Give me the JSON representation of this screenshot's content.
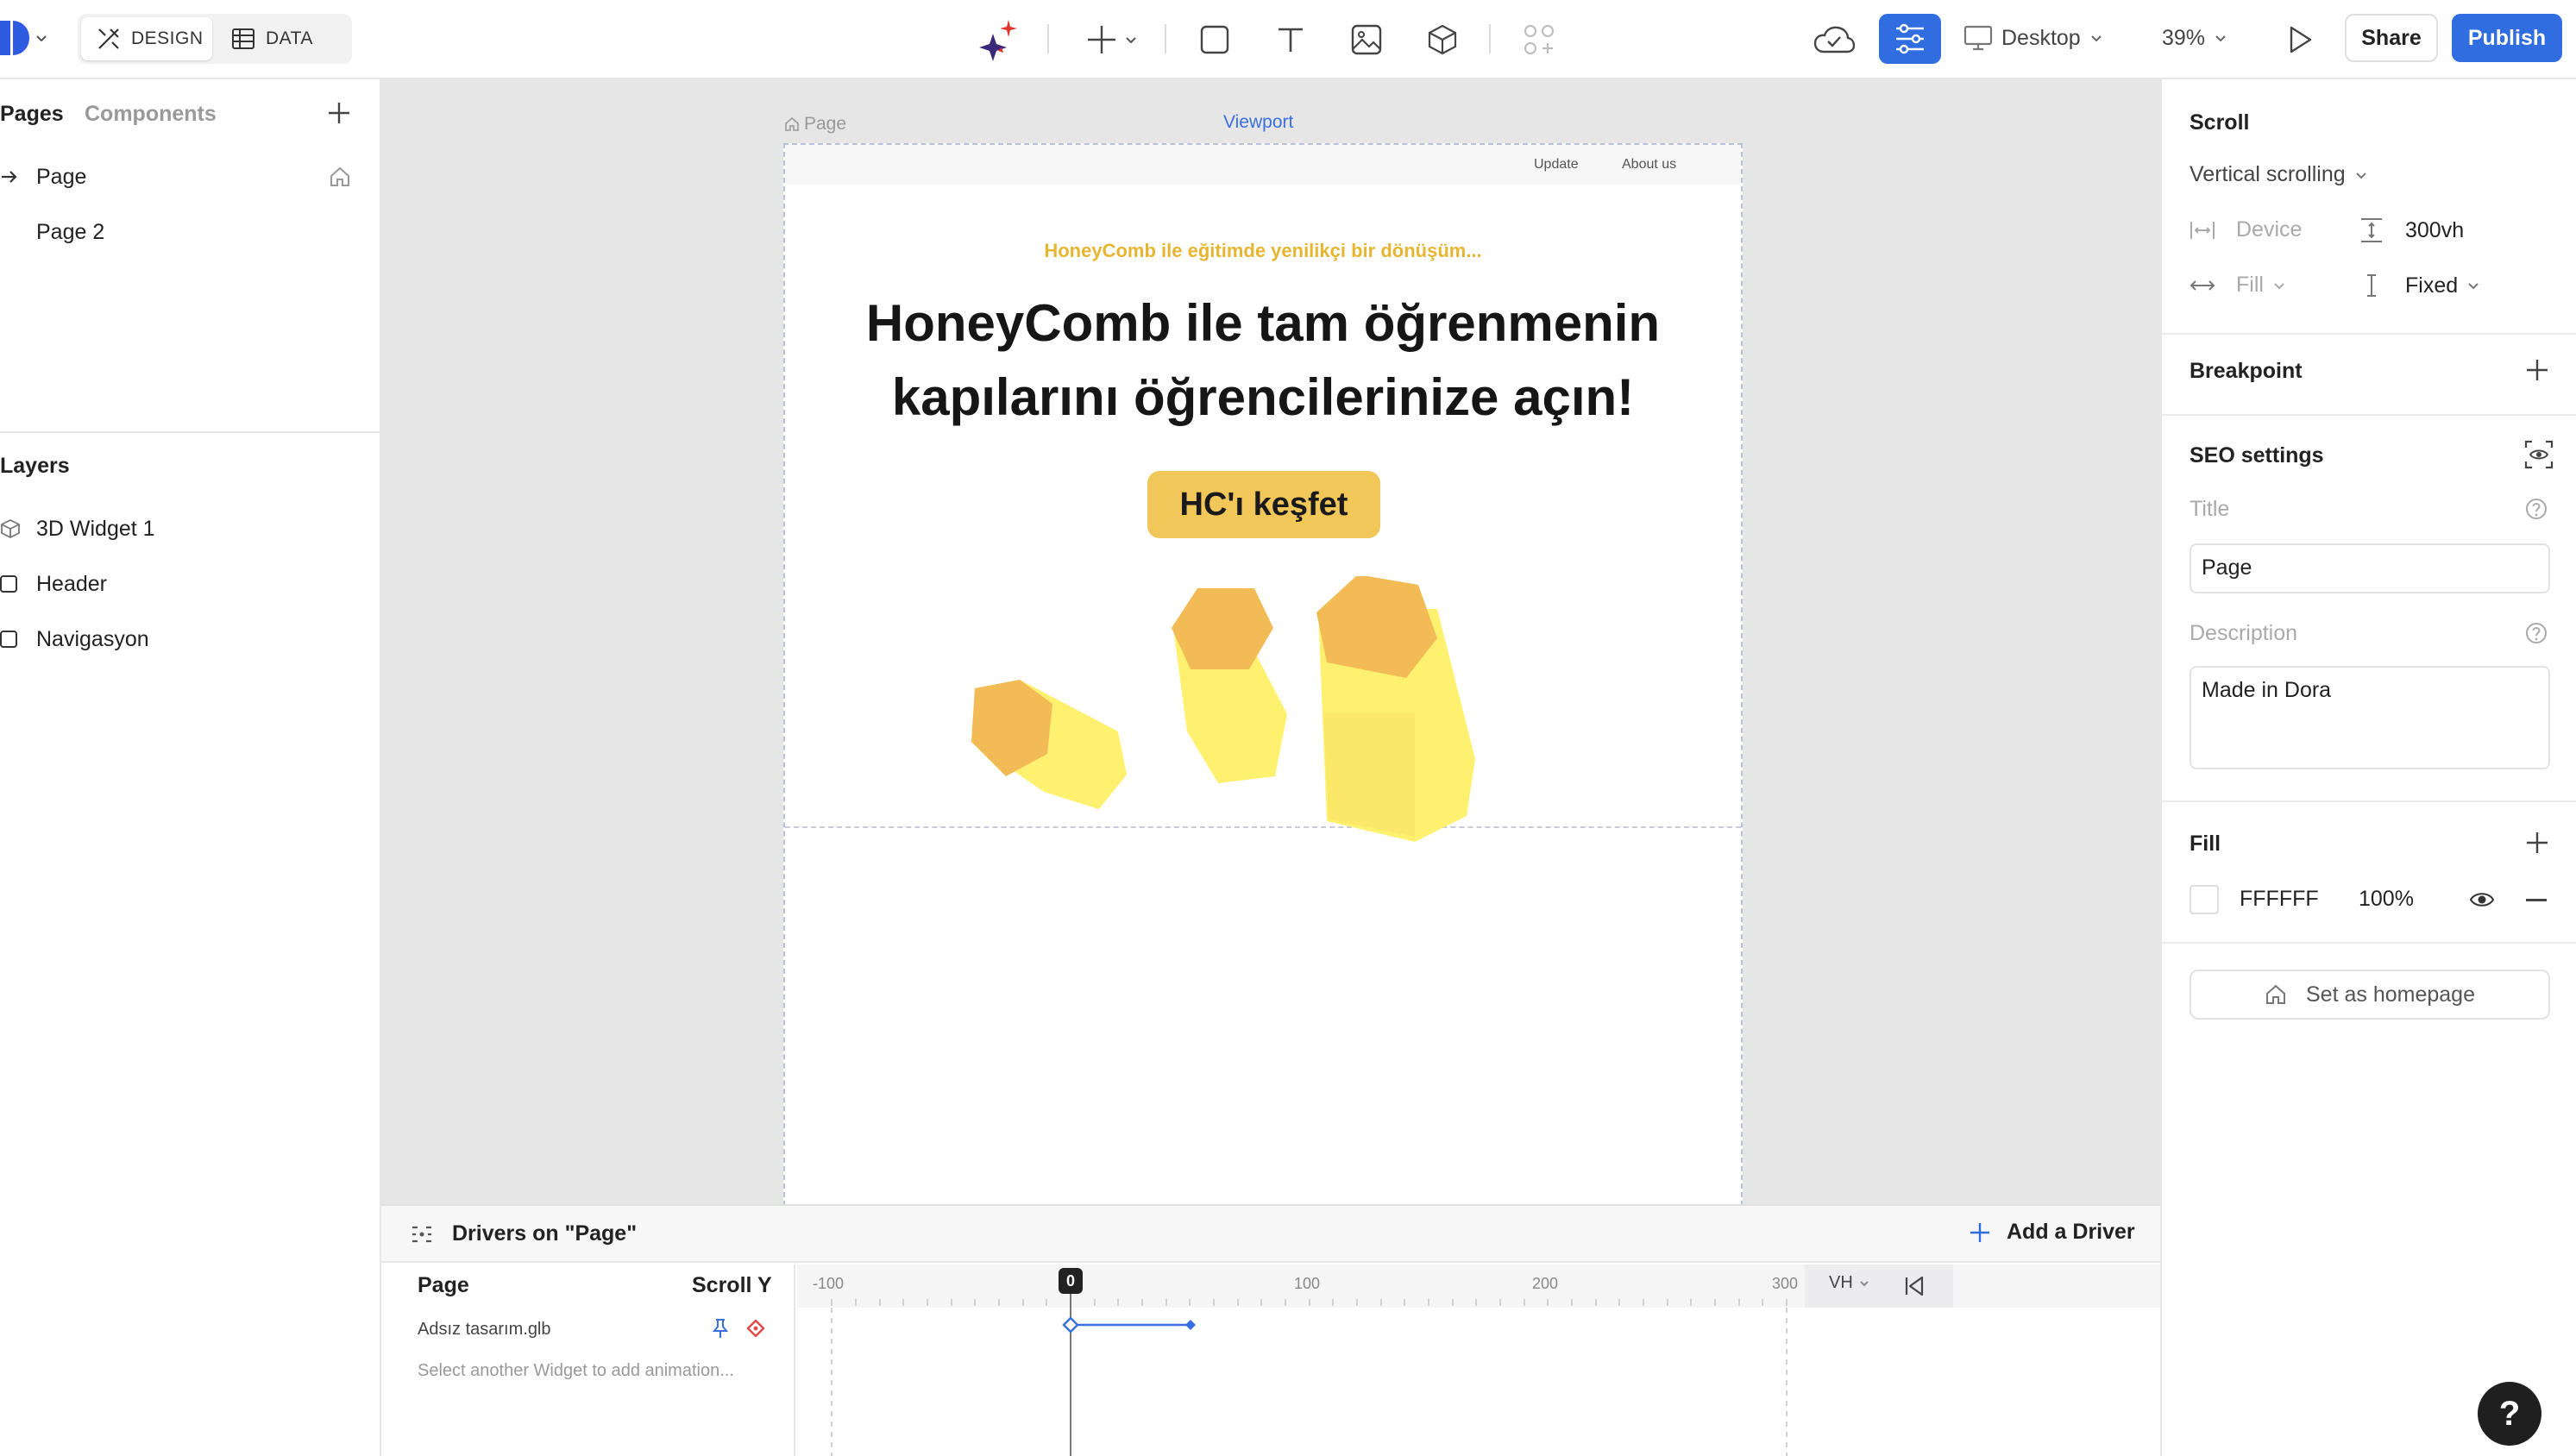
{
  "topbar": {
    "tabs": [
      {
        "label": "DESIGN",
        "icon": "design-tools-icon",
        "active": true
      },
      {
        "label": "DATA",
        "icon": "table-icon",
        "active": false
      }
    ],
    "device": "Desktop",
    "zoom": "39%",
    "share_label": "Share",
    "publish_label": "Publish",
    "accent": "#2f6de1"
  },
  "left": {
    "tabs": {
      "pages": "Pages",
      "components": "Components"
    },
    "pages": [
      {
        "label": "Page",
        "active": true,
        "home": true
      },
      {
        "label": "Page 2",
        "active": false,
        "home": false
      }
    ],
    "layers_title": "Layers",
    "layers": [
      {
        "label": "3D Widget 1",
        "icon": "cube-icon"
      },
      {
        "label": "Header",
        "icon": "frame-icon"
      },
      {
        "label": "Navigasyon",
        "icon": "frame-icon"
      }
    ]
  },
  "canvas": {
    "page_tag": "Page",
    "viewport_label": "Viewport",
    "nav": [
      "Update",
      "About us"
    ],
    "tagline": "HoneyComb ile eğitimde yenilikçi bir dönüşüm...",
    "headline_1": "HoneyComb ile tam öğrenmenin",
    "headline_2": "kapılarını öğrencilerinize açın!",
    "cta": "HC'ı keşfet",
    "tagline_color": "#e6b632",
    "cta_color": "#f1c75a"
  },
  "right": {
    "scroll": {
      "title": "Scroll",
      "mode": "Vertical scrolling",
      "width_label": "Device",
      "height_value": "300vh",
      "width_mode": "Fill",
      "height_mode": "Fixed"
    },
    "breakpoint_title": "Breakpoint",
    "seo": {
      "title": "SEO settings",
      "title_label": "Title",
      "title_value": "Page",
      "description_label": "Description",
      "description_value": "Made in Dora"
    },
    "fill": {
      "title": "Fill",
      "color": "FFFFFF",
      "opacity": "100%"
    },
    "homepage_label": "Set as homepage"
  },
  "bottom": {
    "title": "Drivers on \"Page\"",
    "add_driver": "Add a Driver",
    "col_page": "Page",
    "col_scroll": "Scroll Y",
    "widget": "Adsız tasarım.glb",
    "hint": "Select another Widget to add animation...",
    "ruler": [
      "-100",
      "0",
      "100",
      "200",
      "300"
    ],
    "unit": "VH"
  },
  "help_label": "?"
}
